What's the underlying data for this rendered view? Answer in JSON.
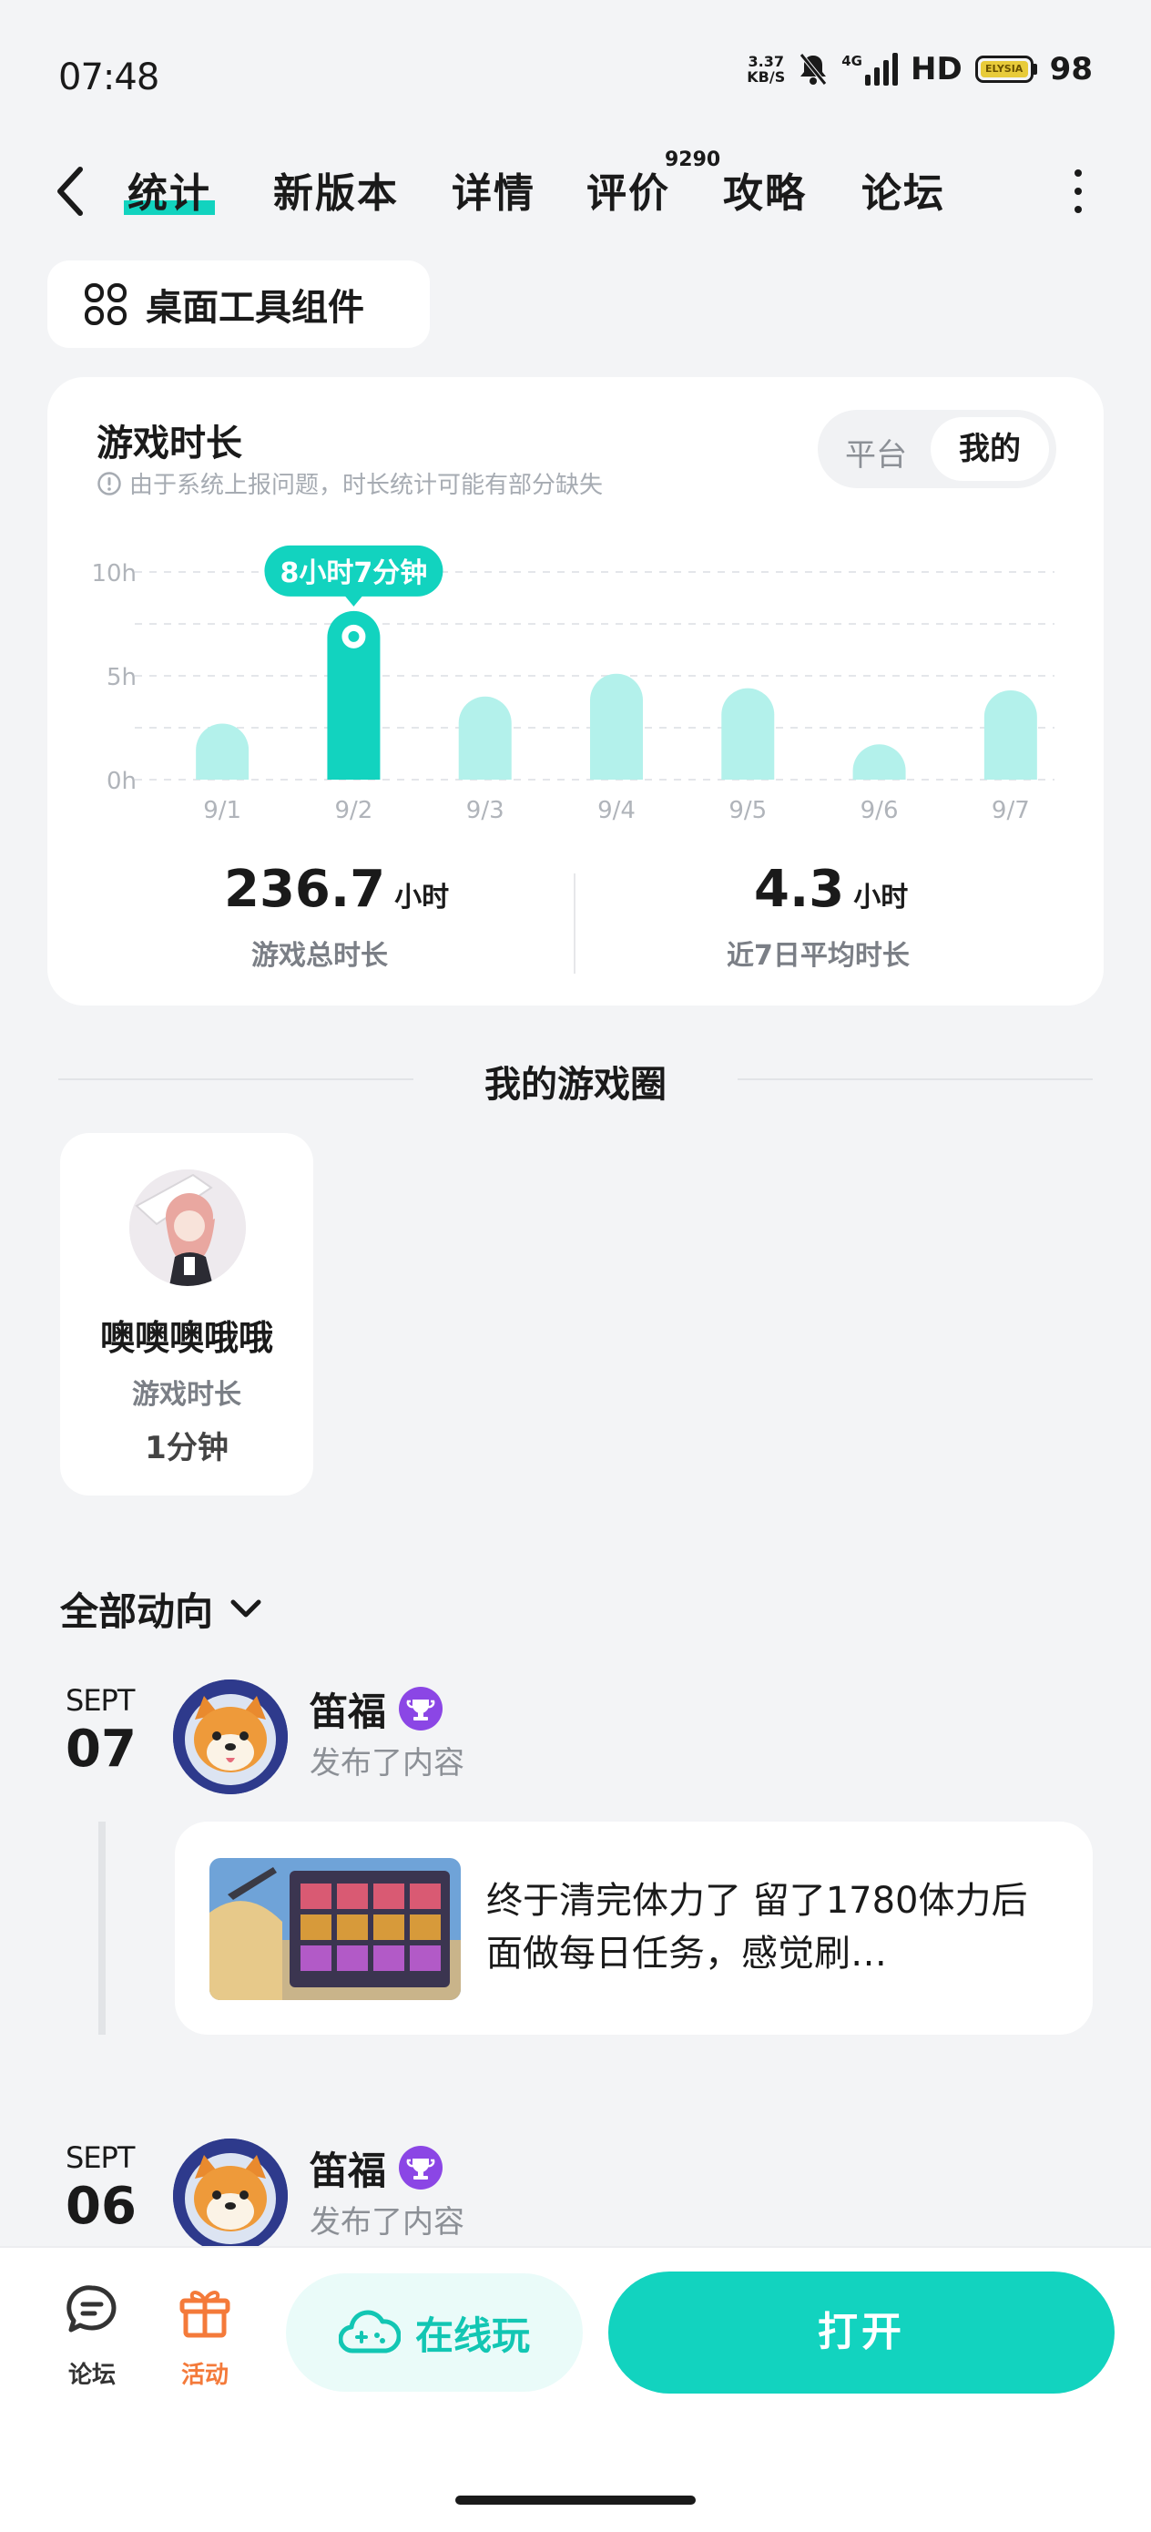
{
  "status": {
    "time": "07:48",
    "speed_top": "3.37",
    "speed_bottom": "KB/S",
    "network": "4G",
    "hd": "HD",
    "battery_brand": "ELYSIA",
    "battery": "98"
  },
  "nav": {
    "tabs": [
      {
        "label": "统计"
      },
      {
        "label": "新版本"
      },
      {
        "label": "详情"
      },
      {
        "label": "评价"
      },
      {
        "label": "攻略"
      },
      {
        "label": "论坛"
      }
    ],
    "review_count": "9290"
  },
  "widget": {
    "label": "桌面工具组件"
  },
  "stats_card": {
    "title": "游戏时长",
    "note": "由于系统上报问题，时长统计可能有部分缺失",
    "toggle": {
      "option_a": "平台",
      "option_b": "我的"
    },
    "total_value": "236.7",
    "total_unit": "小时",
    "total_label": "游戏总时长",
    "avg_value": "4.3",
    "avg_unit": "小时",
    "avg_label": "近7日平均时长"
  },
  "chart_data": {
    "type": "bar",
    "categories": [
      "9/1",
      "9/2",
      "9/3",
      "9/4",
      "9/5",
      "9/6",
      "9/7"
    ],
    "values": [
      2.7,
      8.12,
      4.0,
      5.1,
      4.4,
      1.7,
      4.3
    ],
    "y_tick_labels": [
      "10h",
      "5h",
      "0h"
    ],
    "ylim": [
      0,
      10
    ],
    "highlight_index": 1,
    "tooltip": "8小时7分钟",
    "colors": {
      "bar": "#B3F1EB",
      "highlight": "#12D3BF"
    },
    "grid": true
  },
  "circle": {
    "title": "我的游戏圈",
    "friend": {
      "name": "噢噢噢哦哦",
      "label": "游戏时长",
      "value": "1分钟"
    }
  },
  "feed": {
    "filter_label": "全部动向",
    "posts": [
      {
        "month": "SEPT",
        "day": "07",
        "user": "笛福",
        "action": "发布了内容",
        "text": "终于清完体力了 留了1780体力后面做每日任务，感觉刷…"
      },
      {
        "month": "SEPT",
        "day": "06",
        "user": "笛福",
        "action": "发布了内容"
      }
    ]
  },
  "bottom_bar": {
    "forum": "论坛",
    "events": "活动",
    "play_online": "在线玩",
    "open": "打开"
  }
}
